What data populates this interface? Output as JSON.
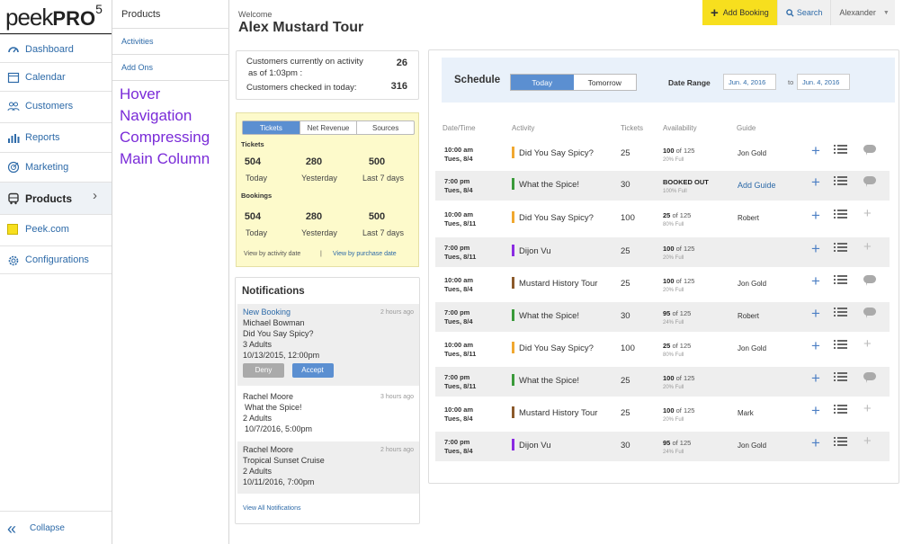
{
  "brand": {
    "logo_word": "peek",
    "logo_pro": "PRO",
    "logo_num": "5"
  },
  "nav": {
    "items": [
      {
        "label": "Dashboard",
        "icon": "dashboard-icon"
      },
      {
        "label": "Calendar",
        "icon": "calendar-icon"
      },
      {
        "label": "Customers",
        "icon": "customers-icon"
      },
      {
        "label": "Reports",
        "icon": "reports-icon"
      },
      {
        "label": "Marketing",
        "icon": "marketing-icon"
      },
      {
        "label": "Products",
        "icon": "products-icon"
      },
      {
        "label": "Peek.com",
        "icon": "peek-com-icon"
      },
      {
        "label": "Configurations",
        "icon": "gear-icon"
      }
    ],
    "collapse": "Collapse"
  },
  "subnav": {
    "title": "Products",
    "items": [
      "Activities",
      "Add Ons"
    ]
  },
  "annotation": [
    "Hover",
    "Navigation",
    "Compressing",
    "Main Column"
  ],
  "header": {
    "welcome": "Welcome",
    "title": "Alex Mustard Tour"
  },
  "topbar": {
    "book": "Add Booking",
    "search": "Search",
    "user": "Alexander"
  },
  "stats": {
    "on_activity_label_1": "Customers currently on activity",
    "on_activity_label_2": "as of 1:03pm :",
    "on_activity_value": "26",
    "checked_in_label": "Customers checked in today:",
    "checked_in_value": "316"
  },
  "summary": {
    "tabs": [
      "Tickets",
      "Net Revenue",
      "Sources"
    ],
    "tickets_header": "Tickets",
    "tickets": [
      {
        "num": "504",
        "label": "Today"
      },
      {
        "num": "280",
        "label": "Yesterday"
      },
      {
        "num": "500",
        "label": "Last 7 days"
      }
    ],
    "bookings_header": "Bookings",
    "bookings": [
      {
        "num": "504",
        "label": "Today"
      },
      {
        "num": "280",
        "label": "Yesterday"
      },
      {
        "num": "500",
        "label": "Last 7 days"
      }
    ],
    "link_activity": "View by activity date",
    "separator": "|",
    "link_purchase": "View by purchase date"
  },
  "notifications": {
    "title": "Notifications",
    "items": [
      {
        "type": "New Booking",
        "time": "2 hours ago",
        "name": "Michael Bowman",
        "activity": "Did You Say Spicy?",
        "guests": "3 Adults",
        "date": "10/13/2015, 12:00pm",
        "deny": "Deny",
        "accept": "Accept"
      },
      {
        "time": "3 hours ago",
        "name": "Rachel Moore",
        "activity": "What the Spice!",
        "guests": "2 Adults",
        "date": "10/7/2016, 5:00pm"
      },
      {
        "time": "2 hours ago",
        "name": "Rachel Moore",
        "activity": "Tropical Sunset Cruise",
        "guests": "2 Adults",
        "date": "10/11/2016, 7:00pm"
      }
    ],
    "view_all": "View All Notifications"
  },
  "schedule": {
    "title": "Schedule",
    "today": "Today",
    "tomorrow": "Tomorrow",
    "range_label": "Date Range",
    "from": "Jun. 4, 2016",
    "to_label": "to",
    "to": "Jun. 4, 2016",
    "columns": [
      "Date/Time",
      "Activity",
      "Tickets",
      "Availability",
      "Guide"
    ],
    "rows": [
      {
        "time": "10:00 am",
        "date": "Tues, 8/4",
        "color": "#f0a830",
        "activity": "Did You Say Spicy?",
        "tickets": "25",
        "avail": "100",
        "of": "of 125",
        "pct": "20% Full",
        "guide": "Jon Gold",
        "msg": "bubble"
      },
      {
        "time": "7:00 pm",
        "date": "Tues, 8/4",
        "color": "#3a9a3a",
        "activity": "What the Spice!",
        "tickets": "30",
        "avail": "BOOKED OUT",
        "of": "",
        "pct": "100% Full",
        "guide": "Add Guide",
        "guide_link": true,
        "msg": "bubble"
      },
      {
        "time": "10:00 am",
        "date": "Tues, 8/11",
        "color": "#f0a830",
        "activity": "Did You Say Spicy?",
        "tickets": "100",
        "avail": "25",
        "of": "of 125",
        "pct": "80% Full",
        "guide": "Robert",
        "msg": "plus"
      },
      {
        "time": "7:00 pm",
        "date": "Tues, 8/11",
        "color": "#8a2be2",
        "activity": "Dijon Vu",
        "tickets": "25",
        "avail": "100",
        "of": "of 125",
        "pct": "20% Full",
        "guide": "",
        "msg": "plus"
      },
      {
        "time": "10:00 am",
        "date": "Tues, 8/4",
        "color": "#8b5a2b",
        "activity": "Mustard History Tour",
        "tickets": "25",
        "avail": "100",
        "of": "of 125",
        "pct": "20% Full",
        "guide": "Jon Gold",
        "msg": "bubble"
      },
      {
        "time": "7:00 pm",
        "date": "Tues, 8/4",
        "color": "#3a9a3a",
        "activity": "What the Spice!",
        "tickets": "30",
        "avail": "95",
        "of": "of 125",
        "pct": "24% Full",
        "guide": "Robert",
        "msg": "bubble"
      },
      {
        "time": "10:00 am",
        "date": "Tues, 8/11",
        "color": "#f0a830",
        "activity": "Did You Say Spicy?",
        "tickets": "100",
        "avail": "25",
        "of": "of 125",
        "pct": "80% Full",
        "guide": "Jon Gold",
        "msg": "plus"
      },
      {
        "time": "7:00 pm",
        "date": "Tues, 8/11",
        "color": "#3a9a3a",
        "activity": "What the Spice!",
        "tickets": "25",
        "avail": "100",
        "of": "of 125",
        "pct": "20% Full",
        "guide": "",
        "msg": "bubble"
      },
      {
        "time": "10:00 am",
        "date": "Tues, 8/4",
        "color": "#8b5a2b",
        "activity": "Mustard History Tour",
        "tickets": "25",
        "avail": "100",
        "of": "of 125",
        "pct": "20% Full",
        "guide": "Mark",
        "msg": "plus"
      },
      {
        "time": "7:00 pm",
        "date": "Tues, 8/4",
        "color": "#8a2be2",
        "activity": "Dijon Vu",
        "tickets": "30",
        "avail": "95",
        "of": "of 125",
        "pct": "24% Full",
        "guide": "Jon Gold",
        "msg": "plus"
      }
    ]
  },
  "colors": {
    "accent": "#5b8fd1",
    "link": "#2d6aa8",
    "book_button": "#f7df1e",
    "annotation": "#7a2bd8"
  }
}
